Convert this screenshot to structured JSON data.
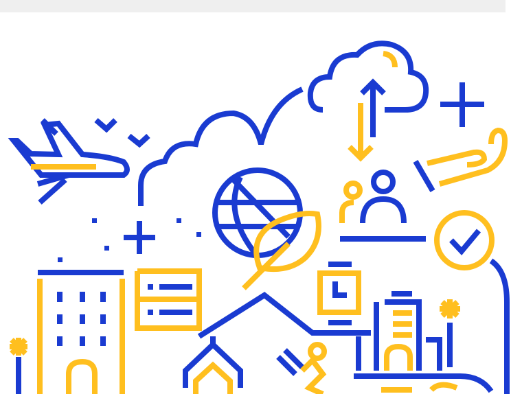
{
  "colors": {
    "blue": "#1a3bd1",
    "yellow": "#ffbf1f",
    "top_bar": "#efefef",
    "background": "#ffffff"
  },
  "illustration": {
    "icons": [
      "airplane-icon",
      "birds-icon",
      "cloud-icon",
      "cloud-upload-icon",
      "plus-icon",
      "hand-icon",
      "globe-icon",
      "leaf-icon",
      "people-icon",
      "checkmark-circle-icon",
      "building-icon",
      "list-card-icon",
      "smartwatch-icon",
      "city-building-icon",
      "palm-tree-icon",
      "houses-icon",
      "runner-icon"
    ]
  }
}
